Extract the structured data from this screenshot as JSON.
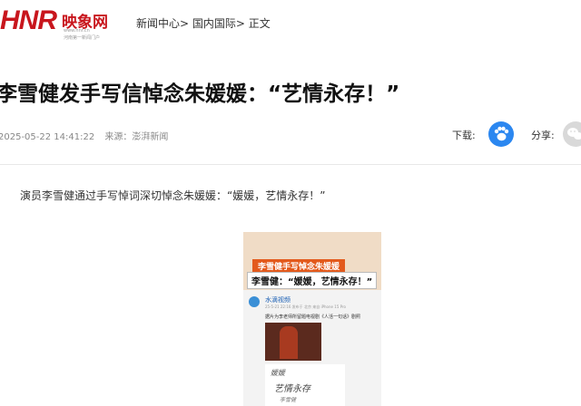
{
  "header": {
    "logo_mark": "HNR",
    "logo_name": "映象网",
    "logo_url": "www.hnr.cn",
    "logo_slogan": "河南第一新闻门户",
    "breadcrumb": [
      "新闻中心>",
      "国内国际>",
      "正文"
    ]
  },
  "article": {
    "title": "李雪健发手写信悼念朱媛媛：“艺情永存！”",
    "datetime": "2025-05-22 14:41:22",
    "source": "来源：澎湃新闻",
    "lead": "演员李雪健通过手写悼词深切悼念朱媛媛：“媛媛，艺情永存！”"
  },
  "actions": {
    "download_label": "下载:",
    "download_icon": "paw-app-icon",
    "share_label": "分享:",
    "share_icon": "wechat-icon",
    "accent": "#2b87f0"
  },
  "figure": {
    "caption1": "李雪健手写悼念朱媛媛",
    "caption2": "李雪健：“媛媛，艺情永存！”",
    "account": "水滴视频",
    "post_date": "25-5-21 22:16 发布于 北京 来自 iPhone 15 Pro",
    "post_text": "据片为李老师所留题电视剧《人活一句话》剧照",
    "hand_line1": "媛媛",
    "hand_line2": "艺情永存",
    "hand_line3": "李雪健"
  }
}
